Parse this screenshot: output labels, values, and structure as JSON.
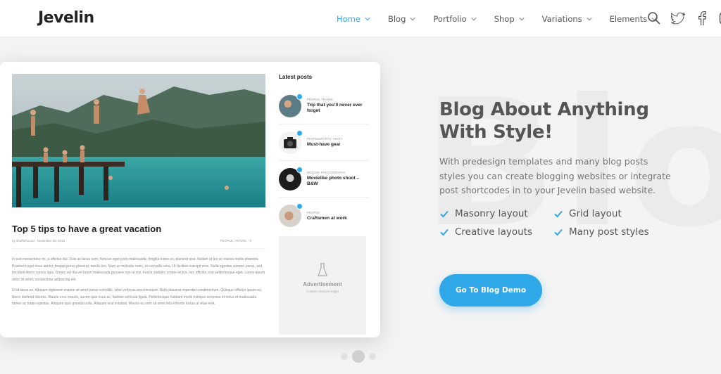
{
  "header": {
    "logo": "Jevelin",
    "nav": [
      {
        "label": "Home",
        "active": true
      },
      {
        "label": "Blog"
      },
      {
        "label": "Portfolio"
      },
      {
        "label": "Shop"
      },
      {
        "label": "Variations"
      },
      {
        "label": "Elements"
      }
    ],
    "icons": [
      "search-icon",
      "twitter-icon",
      "facebook-icon",
      "instagram-icon"
    ]
  },
  "background_word": "Blo",
  "mockup": {
    "post": {
      "title": "Top 5 tips to have a great vacation",
      "meta_left": "by shufflehound · November 25, 2016",
      "meta_right": "PEOPLE, TRAVEL · 0",
      "paragraphs": [
        "In sed consectetur mi, a efficitur dui. Duis ac lacus sem. Aenean eget justo malesuada, fringilla turpis eu, placerat erat. Nullam at leo ac massa mollis pharetra. Praesent eget risus auctor, feugiat purus placerat, iaculis leo. Nam ac molestie nunc, et convallis urna. Ut facilisis suscipit eros. Nulla egestas semper purus, sed tincidunt libero cursus quis. Donec vel dui vel lorem malesuada posuere non ut nisi. Fusce sodales ornare lectus, nec efficitur erat pellentesque eget. Lorem ipsum dolor sit amet, consectetur adipiscing elit.",
        "Ut id lacus ex. Aliquam dignissim mauris sit amet purus convallis, vitae vehicula arcu tincidunt. Nulla placerat imperdiet condimentum. Quisque efficitur ipsum eu libero eleifend lobortis. Mauris eros mauris, auctor quis risus ac, facilisis vehicula ligula. Pellentesque habitant morbi tristique senectus et netus et malesuada fames ac turpis egestas. Aliquam quis gravida nulla. Aliquam erat volutpat. Mauris eu sem sit amet felis lobortis luctus ut vitae erat."
      ]
    },
    "sidebar": {
      "title": "Latest posts",
      "items": [
        {
          "category": "PEOPLE, TRAVEL",
          "title": "Trip that you'll never ever forget"
        },
        {
          "category": "PHOTOGRAPHY, TECH",
          "title": "Must-have gear"
        },
        {
          "category": "DESIGN, PHOTOGRAPHY",
          "title": "Movielike photo shoot – B&W"
        },
        {
          "category": "PEOPLE",
          "title": "Craftsmen at work"
        }
      ],
      "ad_title": "Advertisement",
      "ad_sub": "Custom Vertical Height"
    }
  },
  "content": {
    "headline_line1": "Blog About Anything",
    "headline_line2": "With Style!",
    "description": "With predesign templates and many blog posts styles you can create blogging websites or integrate post shortcodes in to your Jevelin based website.",
    "features": [
      "Masonry layout",
      "Grid layout",
      "Creative layouts",
      "Many post styles"
    ],
    "cta": "Go To Blog Demo"
  },
  "pager": {
    "count": 3,
    "active": 2
  },
  "colors": {
    "accent": "#2fa8e9",
    "background": "#f4f4f4"
  }
}
